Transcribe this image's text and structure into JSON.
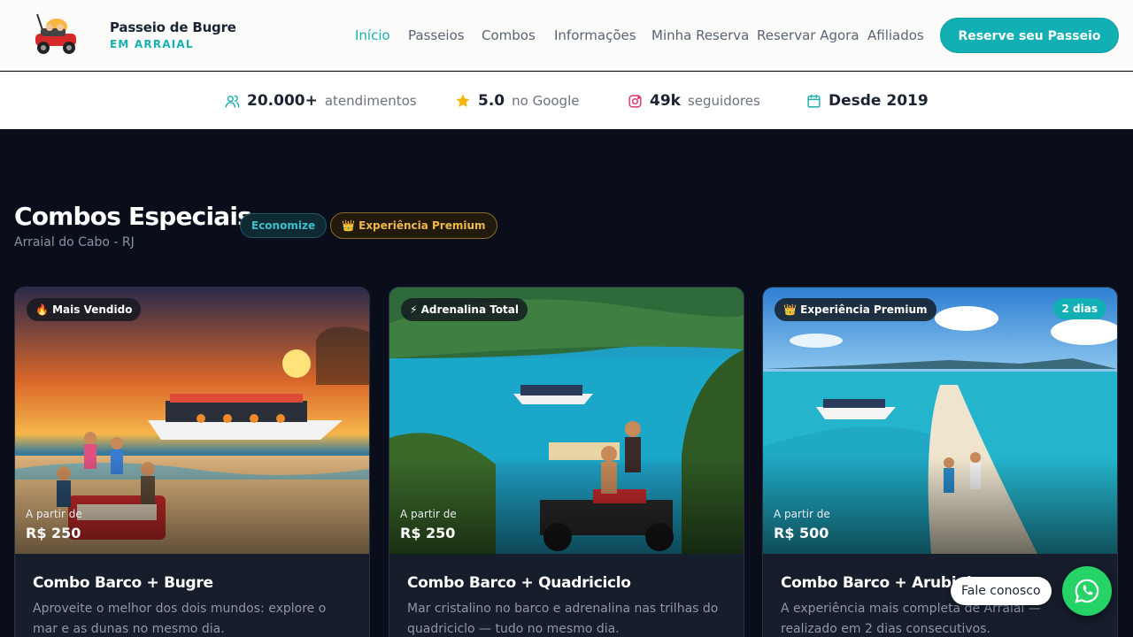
{
  "header": {
    "brand_title": "Passeio de Bugre",
    "brand_subtitle": "EM ARRAIAL",
    "logo_icon": "buggy-logo-icon",
    "nav": [
      {
        "label": "Início",
        "active": true
      },
      {
        "label": "Passeios",
        "active": false
      },
      {
        "label": "Combos",
        "active": false
      },
      {
        "label": "Informações",
        "active": false
      },
      {
        "label": "Minha Reserva",
        "active": false
      },
      {
        "label": "Reservar Agora",
        "active": false
      },
      {
        "label": "Afiliados",
        "active": false
      }
    ],
    "cta_label": "Reserve seu Passeio"
  },
  "stats": [
    {
      "icon": "users-icon",
      "value": "20.000+",
      "label": "atendimentos"
    },
    {
      "icon": "star-icon",
      "value": "5.0",
      "label": "no Google"
    },
    {
      "icon": "instagram-icon",
      "value": "49k",
      "label": "seguidores"
    },
    {
      "icon": "calendar-icon",
      "value": "Desde 2019",
      "label": ""
    }
  ],
  "section": {
    "title": "Combos Especiais",
    "subtitle": "Arraial do Cabo - RJ",
    "tag_economize": "Economize",
    "tag_premium": "👑 Experiência Premium"
  },
  "cards": [
    {
      "badge": "🔥 Mais Vendido",
      "days": "",
      "price_from": "A partir de",
      "price": "R$ 250",
      "title": "Combo Barco + Bugre",
      "description": "Aproveite o melhor dos dois mundos: explore o mar e as dunas no mesmo dia."
    },
    {
      "badge": "⚡ Adrenalina Total",
      "days": "",
      "price_from": "A partir de",
      "price": "R$ 250",
      "title": "Combo Barco + Quadriciclo",
      "description": "Mar cristalino no barco e adrenalina nas trilhas do quadriciclo — tudo no mesmo dia."
    },
    {
      "badge": "👑 Experiência Premium",
      "days": "2 dias",
      "price_from": "A partir de",
      "price": "R$ 500",
      "title": "Combo Barco + Arubinha",
      "description": "A experiência mais completa de Arraial — realizado em 2 dias consecutivos."
    }
  ],
  "contact": {
    "label": "Fale conosco",
    "icon": "whatsapp-icon"
  },
  "colors": {
    "accent": "#12b0b4",
    "section_bg": "#090e1a",
    "card_bg": "#161d2b",
    "premium_gold": "#f0b84a"
  }
}
